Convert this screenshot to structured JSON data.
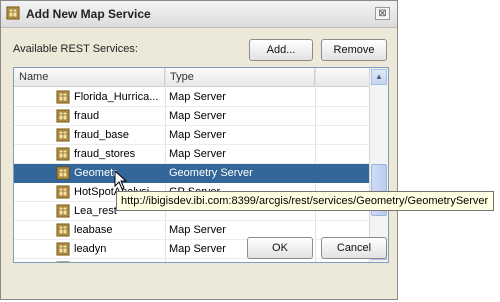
{
  "window": {
    "title": "Add New Map Service",
    "close_glyph": "⊠"
  },
  "available_label": "Available REST Services:",
  "buttons": {
    "add": "Add...",
    "remove": "Remove",
    "ok": "OK",
    "cancel": "Cancel"
  },
  "table": {
    "columns": [
      "Name",
      "Type"
    ],
    "rows": [
      {
        "name": "Florida_Hurrica...",
        "type": "Map Server",
        "icon": "map-service-icon",
        "selected": false
      },
      {
        "name": "fraud",
        "type": "Map Server",
        "icon": "map-service-icon",
        "selected": false
      },
      {
        "name": "fraud_base",
        "type": "Map Server",
        "icon": "map-service-icon",
        "selected": false
      },
      {
        "name": "fraud_stores",
        "type": "Map Server",
        "icon": "map-service-icon",
        "selected": false
      },
      {
        "name": "Geometr",
        "type": "Geometry Server",
        "icon": "map-service-icon",
        "selected": true
      },
      {
        "name": "HotSpotAnalysi",
        "type": "GP Server",
        "icon": "map-service-icon",
        "selected": false
      },
      {
        "name": "Lea_rest",
        "type": "",
        "icon": "map-service-icon",
        "selected": false
      },
      {
        "name": "leabase",
        "type": "Map Server",
        "icon": "map-service-icon",
        "selected": false
      },
      {
        "name": "leadyn",
        "type": "Map Server",
        "icon": "map-service-icon",
        "selected": false
      },
      {
        "name": "",
        "type": "",
        "icon": "map-service-icon",
        "selected": false
      }
    ]
  },
  "tooltip": "http://ibigisdev.ibi.com:8399/arcgis/rest/services/Geometry/GeometryServer",
  "colors": {
    "selection": "#336699",
    "dialog_bg": "#ece9d8",
    "tooltip_bg": "#ffffe1"
  }
}
